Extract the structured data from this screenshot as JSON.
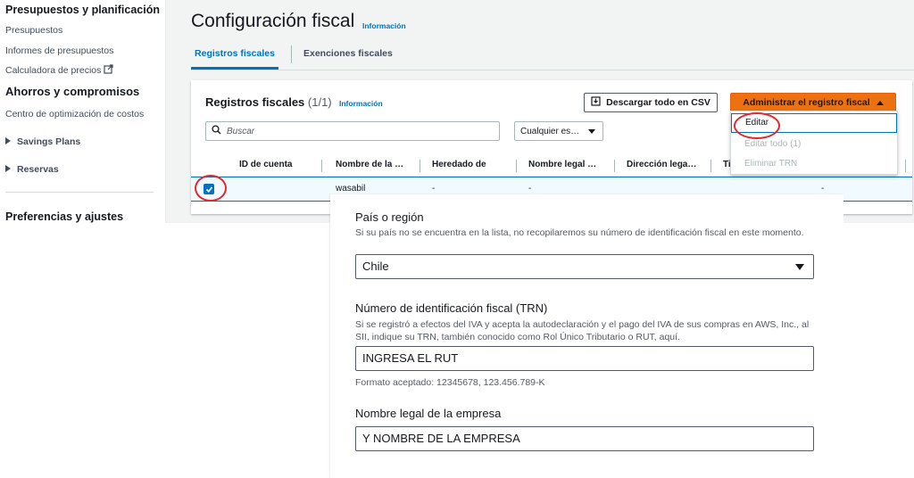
{
  "sidebar": {
    "section1_title": "Presupuestos y planificación",
    "items1": [
      "Presupuestos",
      "Informes de presupuestos",
      "Calculadora de precios"
    ],
    "section2_title": "Ahorros y compromisos",
    "items2": [
      "Centro de optimización de costos"
    ],
    "expandables": [
      "Savings Plans",
      "Reservas"
    ],
    "section3_title": "Preferencias y ajustes"
  },
  "page": {
    "title": "Configuración fiscal",
    "info": "Información",
    "tabs": [
      "Registros fiscales",
      "Exenciones fiscales"
    ]
  },
  "card": {
    "title": "Registros fiscales",
    "count": "(1/1)",
    "info": "Información",
    "download_btn": "Descargar todo en CSV",
    "admin_btn": "Administrar el registro fiscal",
    "search_placeholder": "Buscar",
    "filter_value": "Cualquier es…",
    "columns": [
      "ID de cuenta",
      "Nombre de la …",
      "Heredado de",
      "Nombre legal …",
      "Dirección lega…",
      "Ti"
    ],
    "row": {
      "account_id": "",
      "name": "wasabil",
      "inherited": "-",
      "legal_name": "-",
      "address": "",
      "last": "-"
    },
    "menu": [
      "Editar",
      "Editar todo (1)",
      "Eliminar TRN"
    ]
  },
  "form": {
    "country_label": "País o región",
    "country_desc": "Si su país no se encuentra en la lista, no recopilaremos su número de identificación fiscal en este momento.",
    "country_value": "Chile",
    "trn_label": "Número de identificación fiscal (TRN)",
    "trn_desc": "Si se registró a efectos del IVA y acepta la autodeclaración y el pago del IVA de sus compras en AWS, Inc., al SII, indique su TRN, también conocido como Rol Único Tributario o RUT, aquí.",
    "trn_value": "INGRESA EL RUT",
    "trn_hint": "Formato aceptado: 12345678, 123.456.789-K",
    "company_label": "Nombre legal de la empresa",
    "company_value": "Y NOMBRE DE LA EMPRESA"
  },
  "colors": {
    "accent": "#0073bb",
    "primary_button": "#ec7211",
    "highlight_ring": "#e3292f"
  }
}
